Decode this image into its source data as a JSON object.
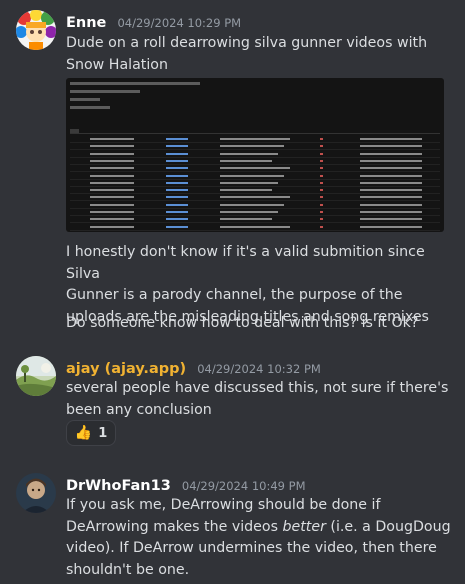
{
  "messages": [
    {
      "author": "Enne",
      "author_color": "#ffffff",
      "timestamp": "04/29/2024 10:29 PM",
      "lines": [
        "Dude on a roll dearrowing silva gunner videos with",
        "Snow Halation"
      ],
      "after_embed": [
        "I honestly don't know if it's a valid submition since Silva",
        "Gunner is a parody channel, the purpose of the",
        "uploads are the misleading titles and song remixes"
      ],
      "followup": "Do someone know how to deal with this? is it Ok?"
    },
    {
      "author": "ajay (ajay.app)",
      "author_color": "#f0b232",
      "timestamp": "04/29/2024 10:32 PM",
      "lines": [
        "several people have discussed this, not sure if there's",
        "been any conclusion"
      ],
      "reaction": {
        "emoji": "👍",
        "count": "1"
      }
    },
    {
      "author": "DrWhoFan13",
      "author_color": "#ffffff",
      "timestamp": "04/29/2024 10:49 PM",
      "text_a": "If you ask me, DeArrowing should be done if",
      "text_b1": "DeArrowing makes the videos ",
      "text_b_em": "better",
      "text_b2": " (i.e. a DougDoug",
      "text_c": "video). If DeArrow undermines the video, then there",
      "text_d": "shouldn't be one."
    }
  ]
}
